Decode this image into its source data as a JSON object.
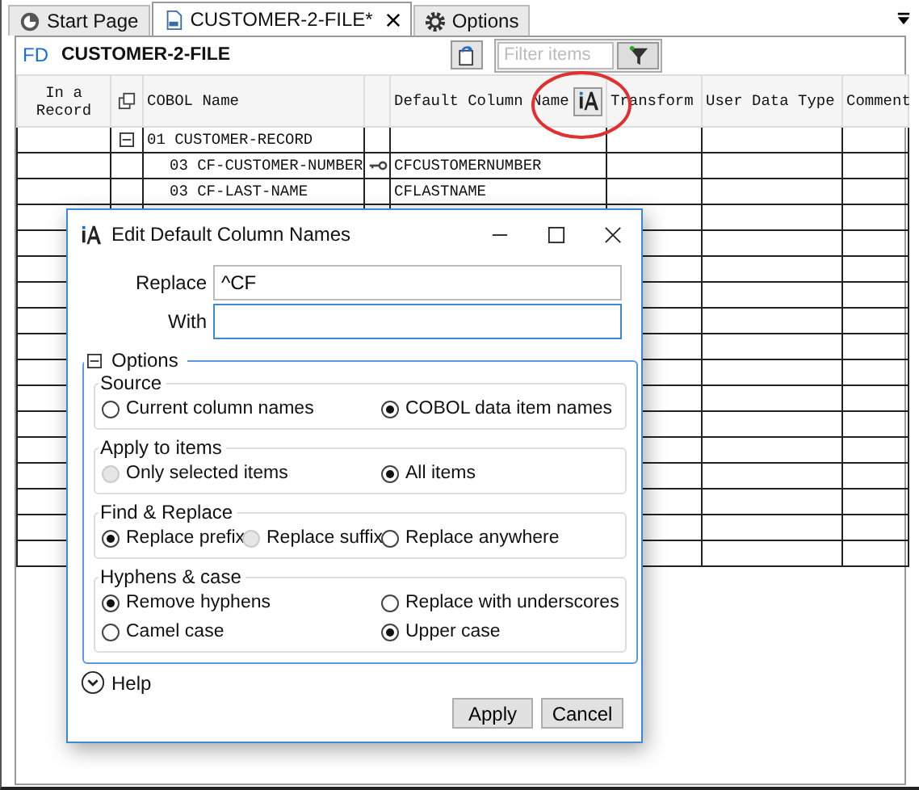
{
  "tabs": [
    {
      "label": "Start Page",
      "selected": false,
      "closable": false
    },
    {
      "label": "CUSTOMER-2-FILE*",
      "selected": true,
      "closable": true
    },
    {
      "label": "Options",
      "selected": false,
      "closable": false
    }
  ],
  "header": {
    "prefix": "FD",
    "title": "CUSTOMER-2-FILE"
  },
  "filter": {
    "placeholder": "Filter items"
  },
  "table": {
    "columns": [
      {
        "kind": "text",
        "label": "In a Record"
      },
      {
        "kind": "icon"
      },
      {
        "kind": "text",
        "label": "COBOL Name"
      },
      {
        "kind": "blank"
      },
      {
        "kind": "text-button",
        "label": "Default Column Name"
      },
      {
        "kind": "text",
        "label": "Transform"
      },
      {
        "kind": "text",
        "label": "User Data Type"
      },
      {
        "kind": "text",
        "label": "Comment"
      }
    ],
    "rows": [
      {
        "cobol_name": "01 CUSTOMER-RECORD",
        "expanded": true,
        "children": [
          {
            "cobol_name": "03 CF-CUSTOMER-NUMBER",
            "key": true,
            "default_name": "CFCUSTOMERNUMBER"
          },
          {
            "cobol_name": "03 CF-LAST-NAME",
            "default_name": "CFLASTNAME"
          }
        ]
      }
    ]
  },
  "dialog": {
    "title": "Edit Default Column Names",
    "fields": [
      {
        "label": "Replace",
        "value": "^CF",
        "focused": false
      },
      {
        "label": "With",
        "focused": true
      }
    ],
    "options": {
      "label": "Options",
      "expanded": true,
      "groups": [
        {
          "title": "Source",
          "rows": [
            [
              {
                "label": "Current column names",
                "selected": false,
                "disabled": false
              },
              {
                "label": "COBOL data item names",
                "selected": true,
                "disabled": false
              }
            ]
          ]
        },
        {
          "title": "Apply to items",
          "rows": [
            [
              {
                "label": "Only selected items",
                "selected": false,
                "disabled": true
              },
              {
                "label": "All items",
                "selected": true,
                "disabled": false
              }
            ]
          ]
        },
        {
          "title": "Find & Replace",
          "rows": [
            [
              {
                "label": "Replace prefix",
                "selected": true,
                "disabled": false
              },
              {
                "label": "Replace suffix",
                "selected": false,
                "disabled": true
              },
              {
                "label": "Replace anywhere",
                "selected": false,
                "disabled": false
              }
            ]
          ]
        },
        {
          "title": "Hyphens & case",
          "rows": [
            [
              {
                "label": "Remove hyphens",
                "selected": true,
                "disabled": false
              },
              {
                "label": "Replace with underscores",
                "selected": false,
                "disabled": false
              }
            ],
            [
              {
                "label": "Camel case",
                "selected": false,
                "disabled": false
              },
              {
                "label": "Upper case",
                "selected": true,
                "disabled": false
              }
            ]
          ]
        }
      ]
    },
    "help": {
      "label": "Help",
      "expanded": false
    },
    "buttons": [
      "Apply",
      "Cancel"
    ]
  }
}
